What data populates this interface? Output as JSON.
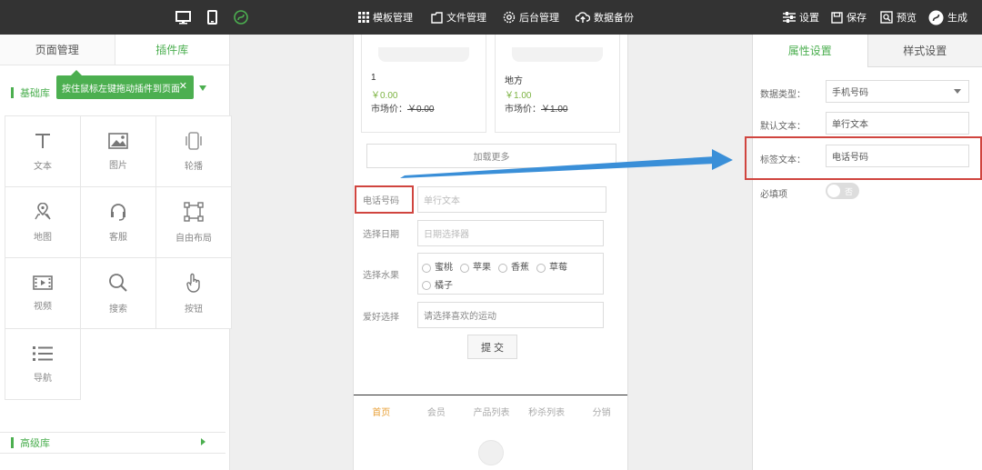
{
  "topbar": {
    "device_desktop_icon": "desktop-icon",
    "device_mobile_icon": "mobile-icon",
    "logo_icon": "logo-icon",
    "menu": [
      {
        "label": "模板管理",
        "icon": "grid-icon"
      },
      {
        "label": "文件管理",
        "icon": "file-icon"
      },
      {
        "label": "后台管理",
        "icon": "gear-icon"
      },
      {
        "label": "数据备份",
        "icon": "cloud-upload-icon"
      }
    ],
    "actions": [
      {
        "label": "设置",
        "icon": "sliders-icon"
      },
      {
        "label": "保存",
        "icon": "save-icon"
      },
      {
        "label": "预览",
        "icon": "preview-icon"
      },
      {
        "label": "生成",
        "icon": "generate-icon"
      }
    ]
  },
  "left_panel": {
    "tabs": [
      {
        "label": "页面管理"
      },
      {
        "label": "插件库"
      }
    ],
    "basic_library": "基础库",
    "tooltip": "按住鼠标左键拖动插件到页面",
    "tooltip_close": "✕",
    "widgets": [
      {
        "label": "文本",
        "icon": "text-icon"
      },
      {
        "label": "图片",
        "icon": "image-icon"
      },
      {
        "label": "轮播",
        "icon": "carousel-icon"
      },
      {
        "label": "地图",
        "icon": "map-pin-icon"
      },
      {
        "label": "客服",
        "icon": "headset-icon"
      },
      {
        "label": "自由布局",
        "icon": "free-layout-icon"
      },
      {
        "label": "视频",
        "icon": "video-icon"
      },
      {
        "label": "搜索",
        "icon": "search-icon"
      },
      {
        "label": "按钮",
        "icon": "pointer-icon"
      },
      {
        "label": "导航",
        "icon": "list-icon"
      }
    ],
    "advanced_library": "高级库"
  },
  "phone": {
    "products": [
      {
        "name": "1",
        "price": "￥0.00",
        "market_label": "市场价：",
        "market_price": "￥0.00"
      },
      {
        "name": "地方",
        "price": "￥1.00",
        "market_label": "市场价：",
        "market_price": "￥1.00"
      }
    ],
    "load_more": "加载更多",
    "form": {
      "phone_label": "电话号码",
      "phone_placeholder": "单行文本",
      "date_label": "选择日期",
      "date_placeholder": "日期选择器",
      "fruit_label": "选择水果",
      "fruits": [
        "蜜桃",
        "苹果",
        "香蕉",
        "草莓",
        "橘子"
      ],
      "hobby_label": "爱好选择",
      "hobby_placeholder": "请选择喜欢的运动",
      "submit": "提 交"
    },
    "tabbar": [
      {
        "label": "首页"
      },
      {
        "label": "会员"
      },
      {
        "label": "产品列表"
      },
      {
        "label": "秒杀列表"
      },
      {
        "label": "分销"
      }
    ]
  },
  "right_panel": {
    "tabs": [
      {
        "label": "属性设置"
      },
      {
        "label": "样式设置"
      }
    ],
    "data_type_label": "数据类型：",
    "data_type_value": "手机号码",
    "default_text_label": "默认文本：",
    "default_text_value": "单行文本",
    "tag_text_label": "标签文本：",
    "tag_text_value": "电话号码",
    "required_label": "必填项",
    "required_value": "否"
  },
  "colors": {
    "accent": "#4caf50",
    "topbar": "#333333",
    "annotation_red": "#d0453f",
    "arrow_blue": "#3a8fd8"
  }
}
